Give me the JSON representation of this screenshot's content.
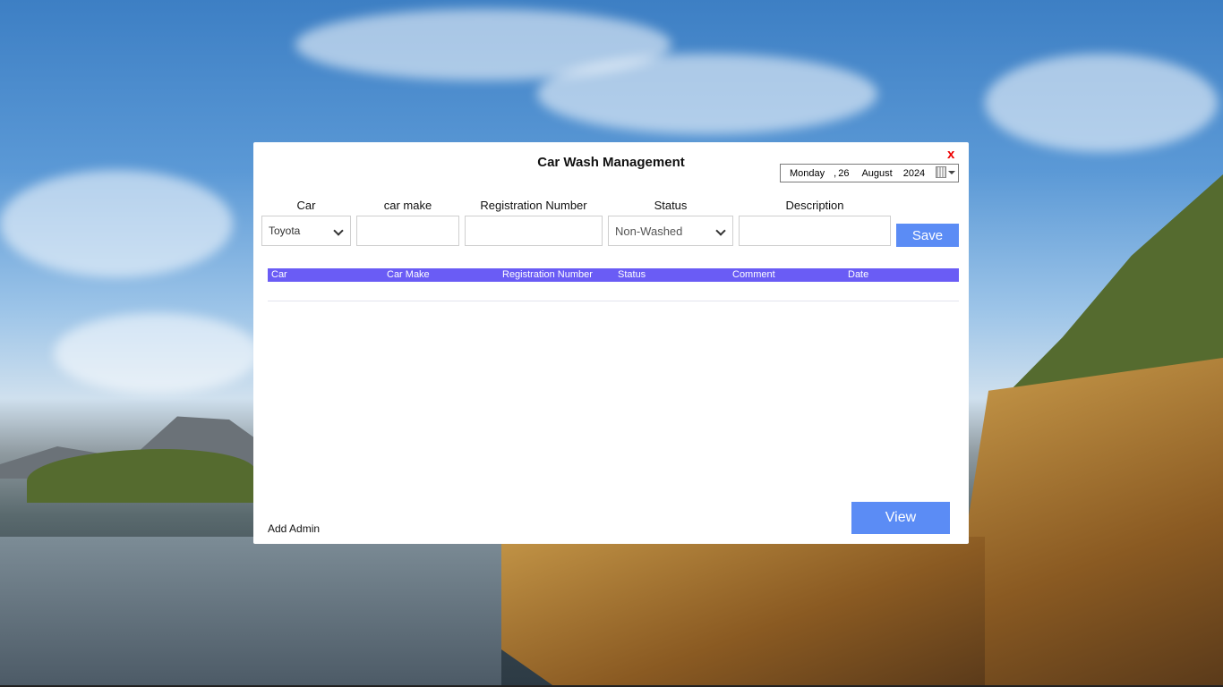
{
  "window": {
    "title": "Car Wash Management",
    "close_label": "x"
  },
  "date_picker": {
    "day_name": "Monday",
    "separator": ",",
    "day": "26",
    "month": "August",
    "year": "2024",
    "button_icon": "calendar-icon"
  },
  "form": {
    "labels": {
      "car": "Car",
      "car_make": "car make",
      "registration_number": "Registration Number",
      "status": "Status",
      "description": "Description"
    },
    "car_value": "Toyota",
    "car_make_value": "",
    "registration_value": "",
    "status_value": "Non-Washed",
    "description_value": "",
    "save_label": "Save"
  },
  "grid": {
    "columns": [
      "Car",
      "Car Make",
      "Registration Number",
      "Status",
      "Comment",
      "Date"
    ],
    "rows": [],
    "header_color": "#6a5cf5"
  },
  "footer": {
    "add_admin_label": "Add Admin",
    "view_label": "View"
  },
  "colors": {
    "accent_button": "#5b8cf5",
    "close": "#e00000"
  }
}
